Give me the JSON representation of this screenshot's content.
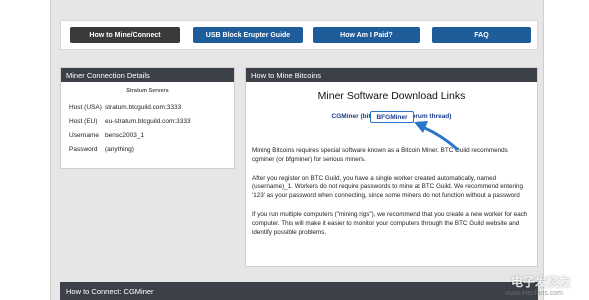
{
  "nav": {
    "items": [
      {
        "label": "How to Mine/Connect",
        "color": "#3a3a3a"
      },
      {
        "label": "USB Block Erupter Guide",
        "color": "#1e5c9a"
      },
      {
        "label": "How Am I Paid?",
        "color": "#1e5c9a"
      },
      {
        "label": "FAQ",
        "color": "#1e5c9a"
      }
    ]
  },
  "miner_details": {
    "title": "Miner Connection Details",
    "subtitle": "Stratum Servers",
    "rows": [
      {
        "key": "Host (USA)",
        "value": "stratum.btcguild.com:3333"
      },
      {
        "key": "Host (EU)",
        "value": "eu-stratum.btcguild.com:3333"
      },
      {
        "key": "Username",
        "value": "bensc2003_1"
      },
      {
        "key": "Password",
        "value": "(anything)"
      }
    ]
  },
  "how_to": {
    "title": "How to Mine Bitcoins",
    "heading": "Miner Software Download Links",
    "link1": "CGMiner (bitcointalk.org forum thread)",
    "link2": "BFGMiner",
    "para1": "Mining Bitcoins requires special software known as a Bitcoin Miner. BTC Guild recommends cgminer (or bfgminer) for serious miners.",
    "para2": "After you register on BTC Guild, you have a single worker created automatically, named (username)_1. Workers do not require passwords to mine at BTC Guild. We recommend entering '123' as your password when connecting, since some miners do not function without a password",
    "para3": "If you run multiple computers (\"mining rigs\"), we recommend that you create a new worker for each computer. This will make it easier to monitor your computers through the BTC Guild website and identify possible problems."
  },
  "bottom": {
    "title": "How to Connect: CGMiner"
  },
  "watermark": {
    "text": "电子发烧友",
    "url": "www.elecfans.com"
  },
  "colors": {
    "arrow": "#2a74c9",
    "panel_header": "#3c4149"
  }
}
